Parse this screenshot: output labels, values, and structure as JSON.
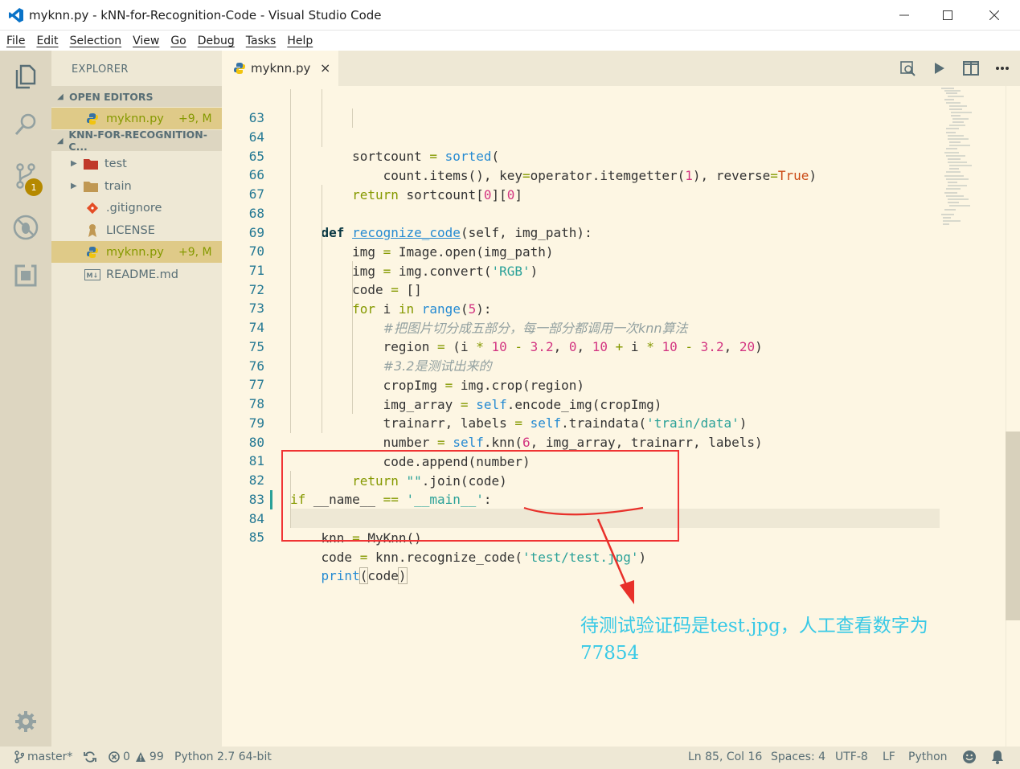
{
  "window": {
    "title": "myknn.py - kNN-for-Recognition-Code - Visual Studio Code"
  },
  "menu": [
    "File",
    "Edit",
    "Selection",
    "View",
    "Go",
    "Debug",
    "Tasks",
    "Help"
  ],
  "sidebar": {
    "title": "EXPLORER",
    "open_editors_header": "OPEN EDITORS",
    "open_editors": [
      {
        "name": "myknn.py",
        "status": "+9, M"
      }
    ],
    "project_header": "KNN-FOR-RECOGNITION-C...",
    "items": [
      {
        "name": "test",
        "type": "folder-red"
      },
      {
        "name": "train",
        "type": "folder"
      },
      {
        "name": ".gitignore",
        "type": "git"
      },
      {
        "name": "LICENSE",
        "type": "license"
      },
      {
        "name": "myknn.py",
        "type": "python",
        "status": "+9, M"
      },
      {
        "name": "README.md",
        "type": "markdown"
      }
    ]
  },
  "activity": {
    "scm_badge": "1"
  },
  "tab": {
    "label": "myknn.py",
    "close": "×"
  },
  "code": {
    "line_numbers": [
      "63",
      "64",
      "65",
      "66",
      "67",
      "68",
      "69",
      "70",
      "71",
      "72",
      "73",
      "74",
      "75",
      "76",
      "77",
      "78",
      "79",
      "80",
      "81",
      "82",
      "83",
      "84",
      "85"
    ]
  },
  "annotation": {
    "text_line1": "待测试验证码是test.jpg，人工查看数字为",
    "text_line2": "77854",
    "color": "#38c9e6",
    "box_color": "#f03434"
  },
  "status": {
    "branch": "master*",
    "errors": "0",
    "warnings": "99",
    "interpreter": "Python 2.7 64-bit",
    "position": "Ln 85, Col 16",
    "spaces": "Spaces: 4",
    "encoding": "UTF-8",
    "eol": "LF",
    "language": "Python"
  },
  "colors": {
    "editor_bg": "#fdf6e3",
    "sidebar_bg": "#eee8d5",
    "activity_bg": "#ddd6c1",
    "keyword": "#859900",
    "function": "#268bd2",
    "string": "#2aa198",
    "number": "#d33682"
  }
}
